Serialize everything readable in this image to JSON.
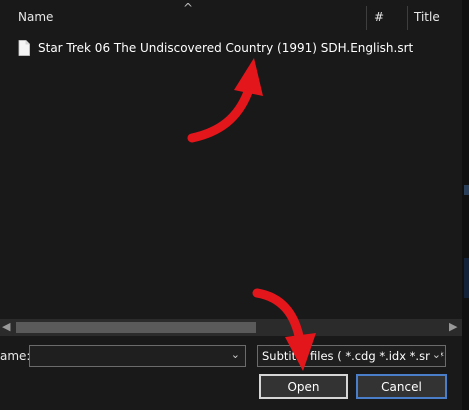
{
  "list": {
    "columns": {
      "name": "Name",
      "hash": "#",
      "title": "Title"
    },
    "sort_indicator": "^",
    "files": [
      {
        "name": "Star Trek 06 The Undiscovered Country (1991) SDH.English.srt",
        "icon": "document-icon"
      }
    ]
  },
  "footer": {
    "name_label": "ame:",
    "name_value": "",
    "file_type_value": "Subtitle files ( *.cdg *.idx *.srt *.",
    "open_label": "Open",
    "cancel_label": "Cancel"
  },
  "annotations": {
    "arrow_color": "#e3161c"
  }
}
